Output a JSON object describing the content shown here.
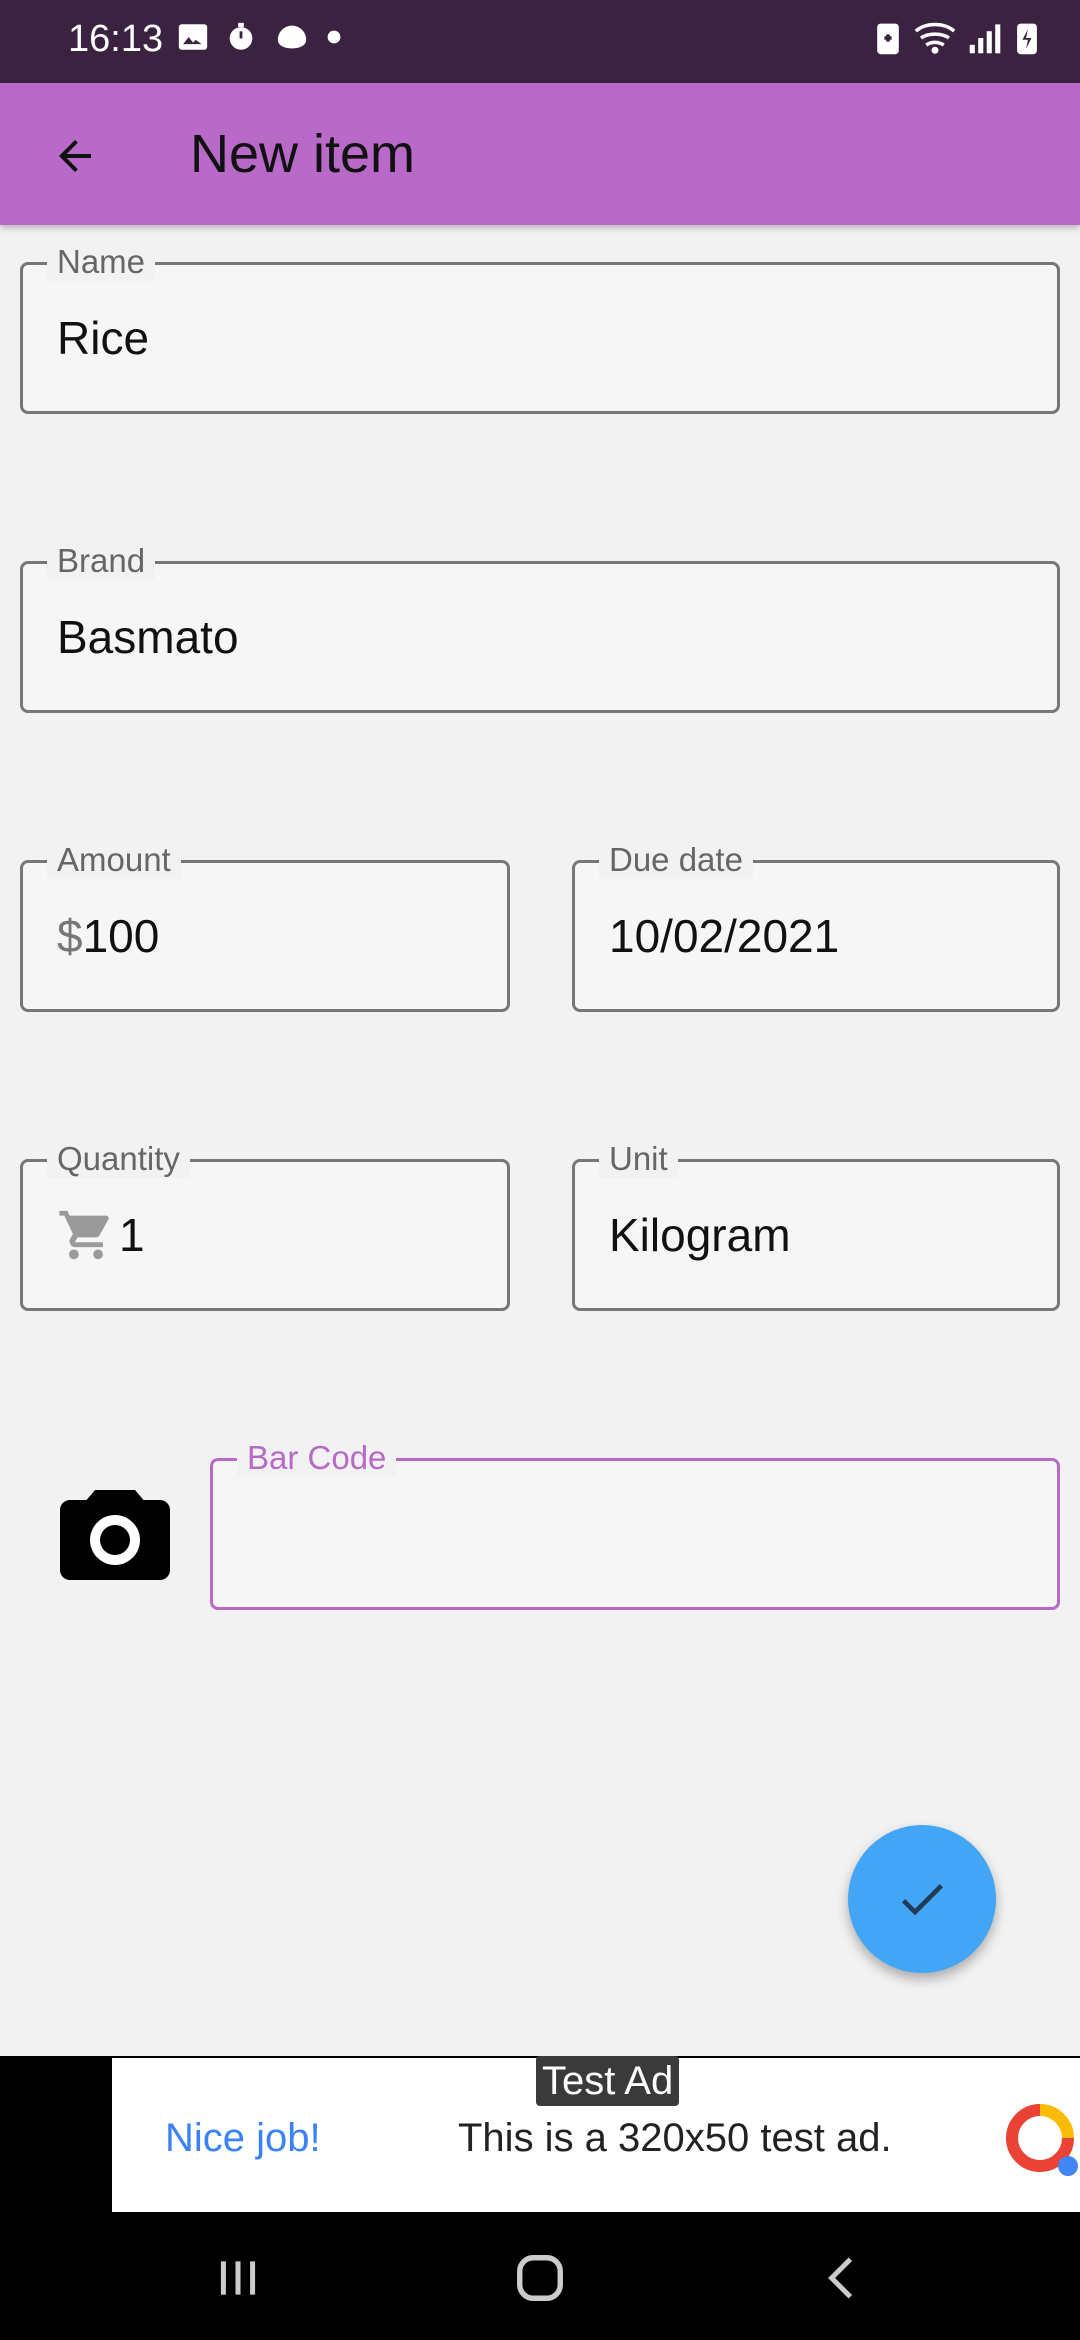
{
  "status": {
    "time": "16:13"
  },
  "appbar": {
    "title": "New item"
  },
  "form": {
    "name": {
      "label": "Name",
      "value": "Rice"
    },
    "brand": {
      "label": "Brand",
      "value": "Basmato"
    },
    "amount": {
      "label": "Amount",
      "prefix": "$",
      "value": "100"
    },
    "due_date": {
      "label": "Due date",
      "value": "10/02/2021"
    },
    "quantity": {
      "label": "Quantity",
      "value": "1"
    },
    "unit": {
      "label": "Unit",
      "value": "Kilogram"
    },
    "barcode": {
      "label": "Bar Code",
      "value": ""
    }
  },
  "ad": {
    "badge": "Test Ad",
    "headline": "Nice job!",
    "text": "This is a 320x50 test ad."
  },
  "colors": {
    "appbar": "#b96ac8",
    "statusbar": "#3c2241",
    "fab": "#42a5f5",
    "focus": "#b96ac8"
  },
  "icons": [
    "back-arrow-icon",
    "camera-icon",
    "check-icon",
    "cart-icon",
    "nav-recents-icon",
    "nav-home-icon",
    "nav-back-icon"
  ]
}
